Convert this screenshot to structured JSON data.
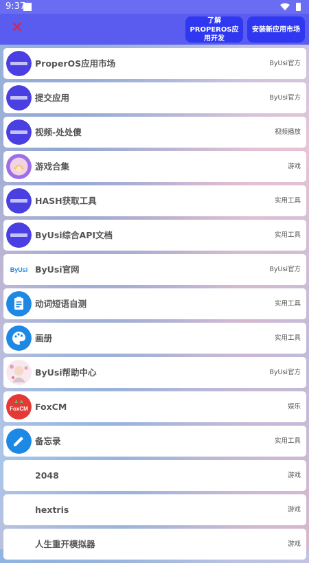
{
  "status": {
    "time": "9:37"
  },
  "toolbar": {
    "learn_label": "了解PROPEROS应用开发",
    "install_label": "安装新应用市场"
  },
  "apps": [
    {
      "name": "ProperOS应用市场",
      "tag": "ByUsi官方",
      "icon": "properos-logo-icon"
    },
    {
      "name": "提交应用",
      "tag": "ByUsi官方",
      "icon": "properos-logo-icon"
    },
    {
      "name": "视频-处处傻",
      "tag": "视频播放",
      "icon": "properos-logo-icon"
    },
    {
      "name": "游戏合集",
      "tag": "游戏",
      "icon": "game-collection-icon"
    },
    {
      "name": "HASH获取工具",
      "tag": "实用工具",
      "icon": "properos-logo-icon"
    },
    {
      "name": "ByUsi综合API文档",
      "tag": "实用工具",
      "icon": "properos-logo-icon"
    },
    {
      "name": "ByUsi官网",
      "tag": "ByUsi官方",
      "icon": "byusi-logo-icon",
      "icon_text": "ByUsi"
    },
    {
      "name": "动词短语自测",
      "tag": "实用工具",
      "icon": "clipboard-icon"
    },
    {
      "name": "画册",
      "tag": "实用工具",
      "icon": "palette-icon"
    },
    {
      "name": "ByUsi帮助中心",
      "tag": "ByUsi官方",
      "icon": "anime-avatar-icon"
    },
    {
      "name": "FoxCM",
      "tag": "娱乐",
      "icon": "foxcm-icon",
      "icon_text": "FoxCM"
    },
    {
      "name": "备忘录",
      "tag": "实用工具",
      "icon": "pencil-icon"
    },
    {
      "name": "2048",
      "tag": "游戏",
      "icon": ""
    },
    {
      "name": "hextris",
      "tag": "游戏",
      "icon": ""
    },
    {
      "name": "人生重开模拟器",
      "tag": "游戏",
      "icon": ""
    }
  ],
  "colors": {
    "topbar": "#5a5cf0",
    "button": "#2f38f0",
    "close": "#e0233a",
    "properos_icon": "#4a3fe0",
    "blue_icon": "#1e88e5",
    "foxcm": "#e53935"
  }
}
